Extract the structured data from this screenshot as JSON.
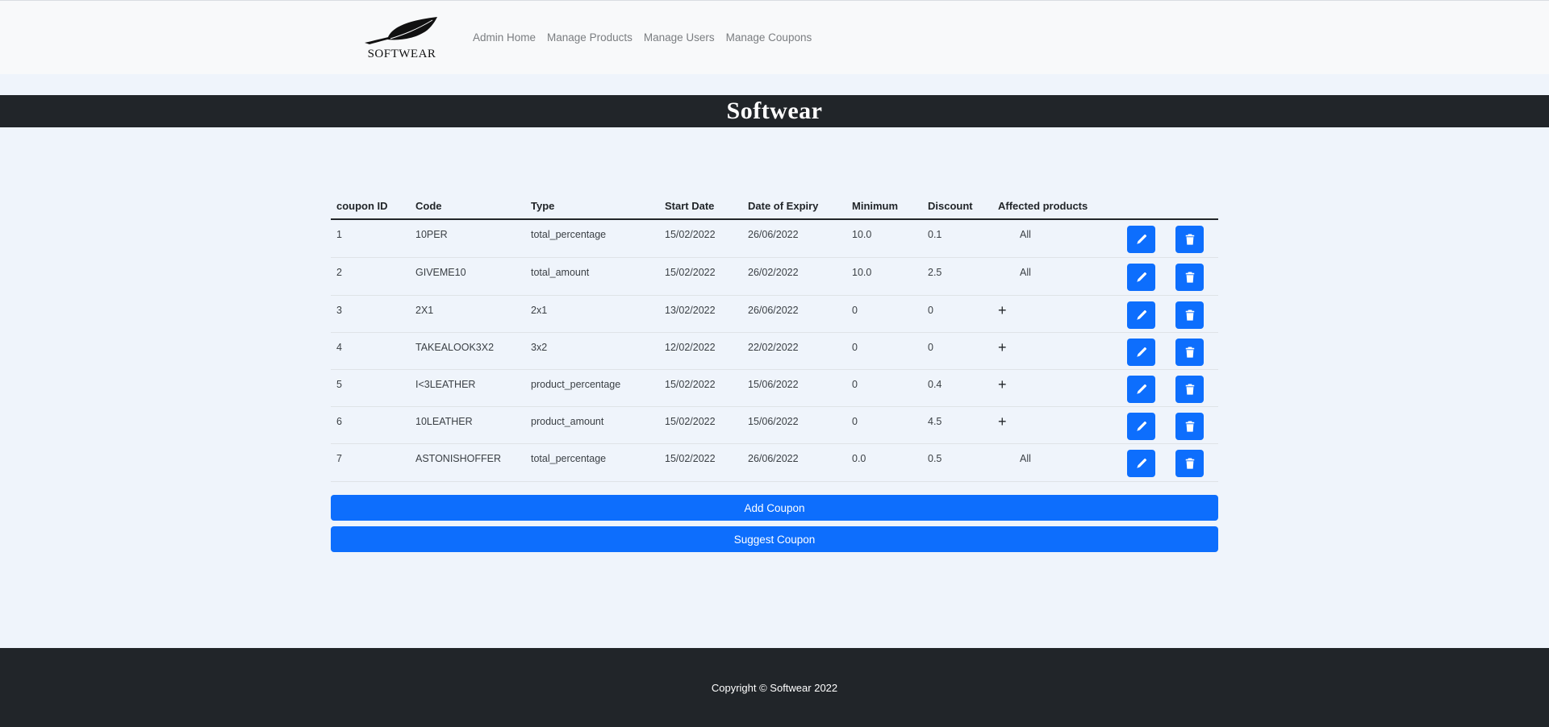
{
  "brand": {
    "name": "SOFTWEAR",
    "logo": "feather-logo"
  },
  "nav": {
    "items": [
      {
        "label": "Admin Home"
      },
      {
        "label": "Manage Products"
      },
      {
        "label": "Manage Users"
      },
      {
        "label": "Manage Coupons"
      }
    ]
  },
  "banner": {
    "title": "Softwear"
  },
  "table": {
    "headers": [
      "coupon ID",
      "Code",
      "Type",
      "Start Date",
      "Date of Expiry",
      "Minimum",
      "Discount",
      "Affected products"
    ],
    "rows": [
      {
        "id": "1",
        "code": "10PER",
        "type": "total_percentage",
        "start": "15/02/2022",
        "expiry": "26/06/2022",
        "minimum": "10.0",
        "discount": "0.1",
        "affected": "All"
      },
      {
        "id": "2",
        "code": "GIVEME10",
        "type": "total_amount",
        "start": "15/02/2022",
        "expiry": "26/02/2022",
        "minimum": "10.0",
        "discount": "2.5",
        "affected": "All"
      },
      {
        "id": "3",
        "code": "2X1",
        "type": "2x1",
        "start": "13/02/2022",
        "expiry": "26/06/2022",
        "minimum": "0",
        "discount": "0",
        "affected": "+"
      },
      {
        "id": "4",
        "code": "TAKEALOOK3X2",
        "type": "3x2",
        "start": "12/02/2022",
        "expiry": "22/02/2022",
        "minimum": "0",
        "discount": "0",
        "affected": "+"
      },
      {
        "id": "5",
        "code": "I<3LEATHER",
        "type": "product_percentage",
        "start": "15/02/2022",
        "expiry": "15/06/2022",
        "minimum": "0",
        "discount": "0.4",
        "affected": "+"
      },
      {
        "id": "6",
        "code": "10LEATHER",
        "type": "product_amount",
        "start": "15/02/2022",
        "expiry": "15/06/2022",
        "minimum": "0",
        "discount": "4.5",
        "affected": "+"
      },
      {
        "id": "7",
        "code": "ASTONISHOFFER",
        "type": "total_percentage",
        "start": "15/02/2022",
        "expiry": "26/06/2022",
        "minimum": "0.0",
        "discount": "0.5",
        "affected": "All"
      }
    ],
    "row_actions": {
      "edit_icon": "pencil-icon",
      "delete_icon": "trash-icon"
    }
  },
  "actions": {
    "add_label": "Add Coupon",
    "suggest_label": "Suggest Coupon"
  },
  "footer": {
    "copyright": "Copyright © Softwear 2022"
  },
  "colors": {
    "primary": "#0d6efd",
    "dark": "#212529",
    "page_bg": "#eff4fb",
    "navbar_bg": "#f8f9fa"
  }
}
